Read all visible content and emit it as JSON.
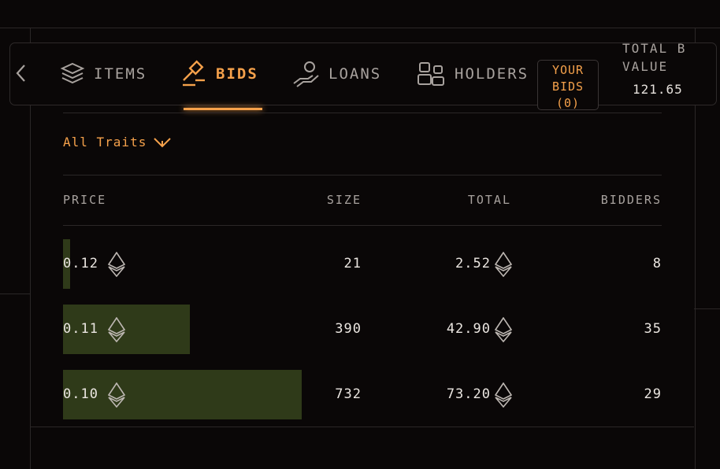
{
  "navigation": {
    "prev_arrow_icon": "chevron-left-icon"
  },
  "tabs": [
    {
      "label": "ITEMS",
      "icon": "stack-icon",
      "active": false
    },
    {
      "label": "BIDS",
      "icon": "gavel-icon",
      "active": true
    },
    {
      "label": "LOANS",
      "icon": "hand-coin-icon",
      "active": false
    },
    {
      "label": "HOLDERS",
      "icon": "users-icon",
      "active": false
    }
  ],
  "your_bids": {
    "line1": "YOUR",
    "line2": "BIDS",
    "count": "(0)"
  },
  "total_bid_value": {
    "label_line1": "TOTAL B",
    "label_line2": "VALUE",
    "value": "121.65"
  },
  "filter": {
    "label": "All Traits"
  },
  "table": {
    "headers": {
      "price": "PRICE",
      "size": "SIZE",
      "total": "TOTAL",
      "bidders": "BIDDERS"
    },
    "rows": [
      {
        "price": "0.12",
        "size": "21",
        "total": "2.52",
        "bidders": "8",
        "depth": 0.029
      },
      {
        "price": "0.11",
        "size": "390",
        "total": "42.90",
        "bidders": "35",
        "depth": 0.53
      },
      {
        "price": "0.10",
        "size": "732",
        "total": "73.20",
        "bidders": "29",
        "depth": 1.0
      }
    ]
  },
  "colors": {
    "accent": "#f5a14b",
    "depth_bar": "#2f3a19",
    "background": "#0a0707"
  }
}
